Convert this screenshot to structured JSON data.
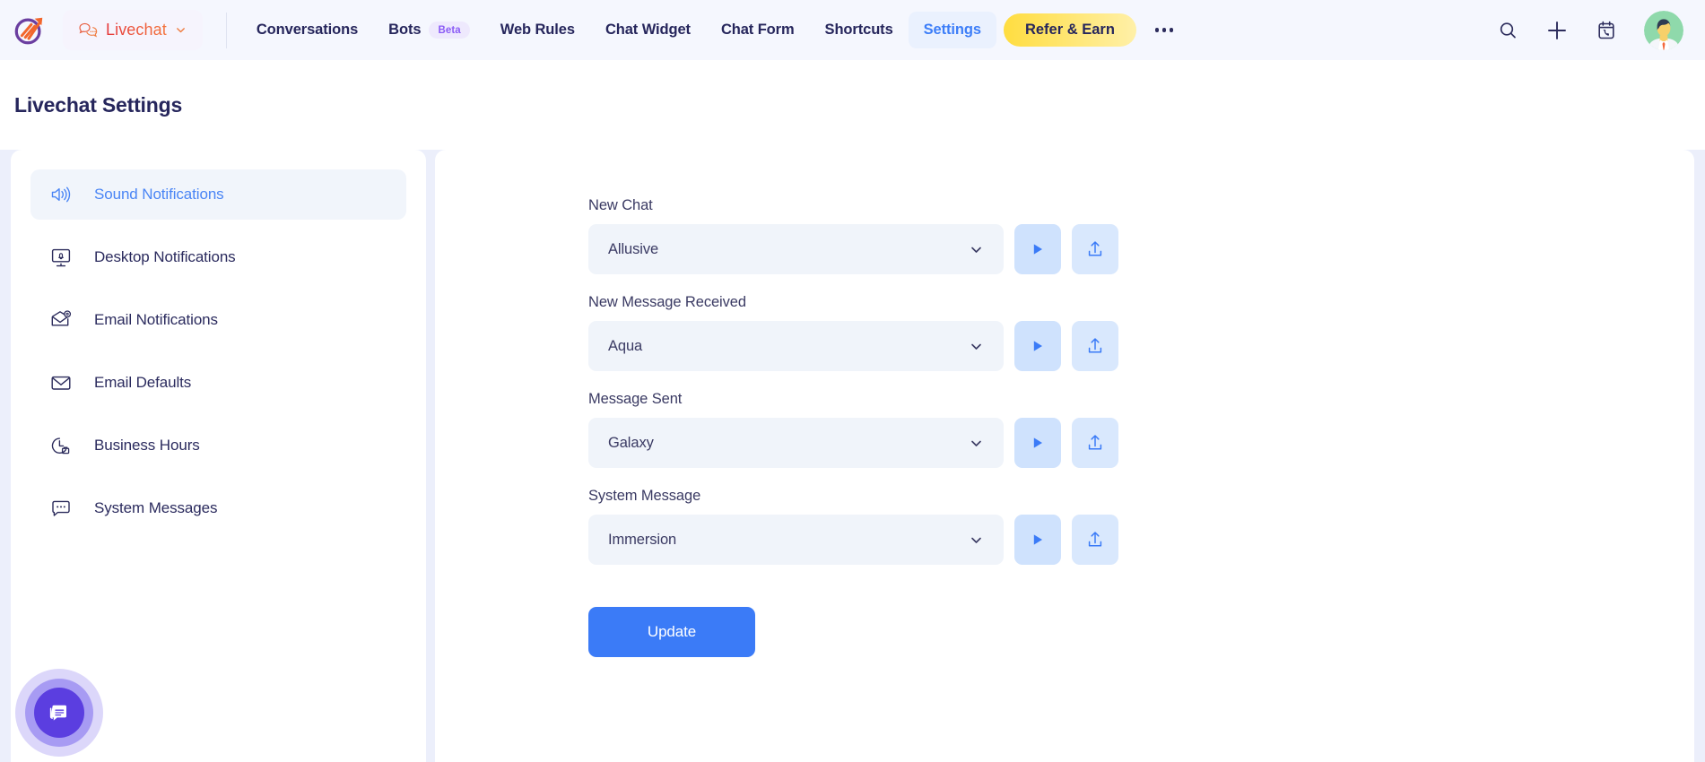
{
  "topbar": {
    "logo_icon": "growth-arrow-logo",
    "product_pill": {
      "icon": "chat-bubble-icon",
      "label": "Livechat",
      "chevron": "chevron-down-icon"
    },
    "nav": [
      {
        "label": "Conversations",
        "badge": null,
        "active": false
      },
      {
        "label": "Bots",
        "badge": "Beta",
        "active": false
      },
      {
        "label": "Web Rules",
        "badge": null,
        "active": false
      },
      {
        "label": "Chat Widget",
        "badge": null,
        "active": false
      },
      {
        "label": "Chat Form",
        "badge": null,
        "active": false
      },
      {
        "label": "Shortcuts",
        "badge": null,
        "active": false
      },
      {
        "label": "Settings",
        "badge": null,
        "active": true
      }
    ],
    "refer_label": "Refer & Earn",
    "overflow_icon": "more-horizontal-icon",
    "right_icons": [
      "search-icon",
      "plus-icon",
      "calendar-phone-icon",
      "user-avatar"
    ]
  },
  "header": {
    "title": "Livechat Settings"
  },
  "sidebar": {
    "items": [
      {
        "label": "Sound Notifications",
        "icon": "speaker-wave-icon",
        "active": true
      },
      {
        "label": "Desktop Notifications",
        "icon": "monitor-bell-icon",
        "active": false
      },
      {
        "label": "Email Notifications",
        "icon": "envelope-at-icon",
        "active": false
      },
      {
        "label": "Email Defaults",
        "icon": "envelope-icon",
        "active": false
      },
      {
        "label": "Business Hours",
        "icon": "clock-briefcase-icon",
        "active": false
      },
      {
        "label": "System Messages",
        "icon": "chat-dots-icon",
        "active": false
      }
    ]
  },
  "main": {
    "fields": [
      {
        "label": "New Chat",
        "value": "Allusive"
      },
      {
        "label": "New Message Received",
        "value": "Aqua"
      },
      {
        "label": "Message Sent",
        "value": "Galaxy"
      },
      {
        "label": "System Message",
        "value": "Immersion"
      }
    ],
    "row_actions": {
      "play_icon": "play-icon",
      "upload_icon": "upload-icon",
      "select_chevron": "chevron-down-icon"
    },
    "update_label": "Update"
  },
  "chat_launcher": {
    "icon": "chat-message-icon"
  },
  "colors": {
    "accent_blue": "#3b7bf7",
    "topbar_bg": "#f5f7fe",
    "page_bg": "#eceffb",
    "nav_text": "#26265c",
    "beta_purple": "#8b5cf6",
    "refer_yellow": "#ffdd40",
    "launcher_purple": "#5b3ee0"
  }
}
